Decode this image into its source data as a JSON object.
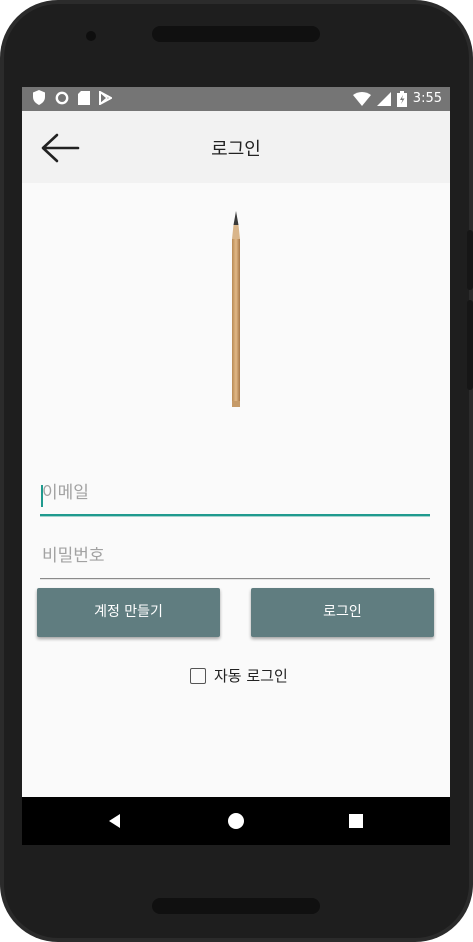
{
  "status_bar": {
    "time": "3:55",
    "left_icons": [
      "shield-icon",
      "circle-icon",
      "sd-card-icon",
      "play-store-icon"
    ],
    "right_icons": [
      "wifi-icon",
      "signal-icon",
      "battery-icon"
    ]
  },
  "app_bar": {
    "title": "로그인",
    "back_icon": "arrow-left-icon"
  },
  "login_form": {
    "email_placeholder": "이메일",
    "email_value": "",
    "password_placeholder": "비밀번호",
    "password_value": "",
    "create_account_label": "계정 만들기",
    "login_label": "로그인",
    "auto_login_label": "자동 로그인",
    "auto_login_checked": false
  },
  "nav_bar": {
    "icons": [
      "back-triangle-icon",
      "home-circle-icon",
      "recents-square-icon"
    ]
  },
  "colors": {
    "accent": "#1f9a8e",
    "button": "#607d80",
    "status_bar": "#757575",
    "app_bar": "#f2f2f2"
  }
}
